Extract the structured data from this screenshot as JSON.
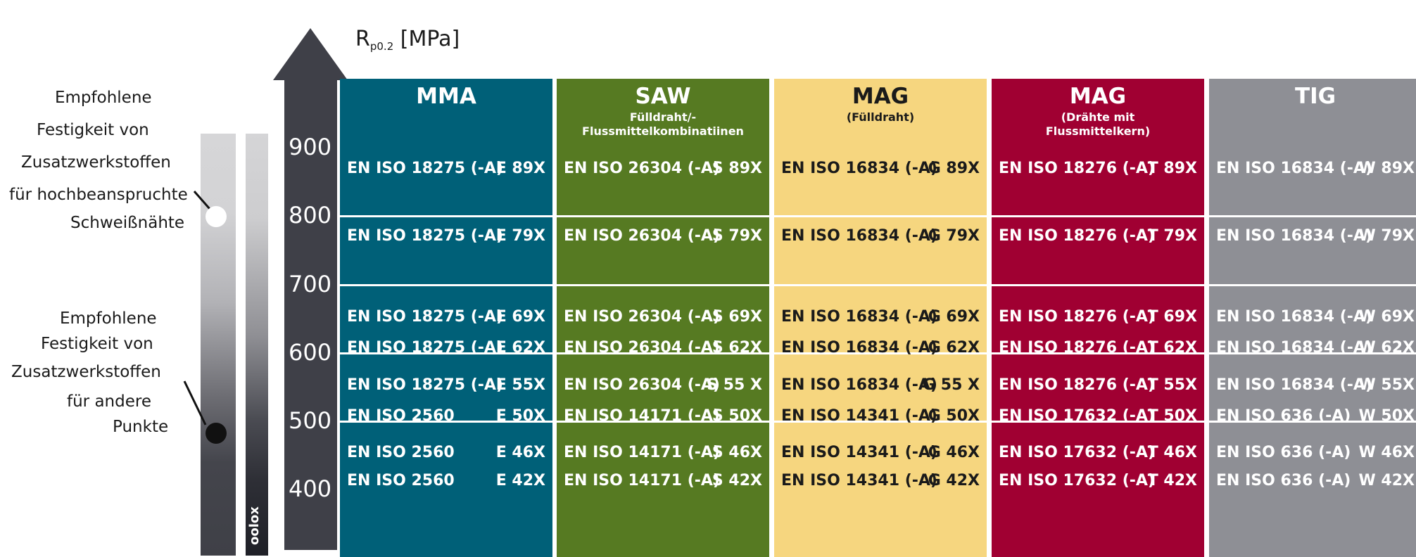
{
  "axis": {
    "label_main": "R",
    "label_sub": "p0.2",
    "label_unit": "[MPa]",
    "ticks": [
      "900",
      "800",
      "700",
      "600",
      "500",
      "400"
    ]
  },
  "notes": {
    "high": [
      "Empfohlene",
      "Festigkeit von",
      "Zusatzwerkstoffen",
      "für hochbeanspruchte",
      "Schweißnähte"
    ],
    "other": [
      "Empfohlene",
      "Festigkeit von",
      "Zusatzwerkstoffen",
      "für andere",
      "Punkte"
    ]
  },
  "bar2_label": "oolox",
  "columns": [
    {
      "title": "MMA",
      "subtitle": "",
      "bg": "#006078",
      "fg": "#ffffff",
      "rows": [
        [
          "EN ISO 18275 (-A)",
          "E 89X"
        ],
        [
          "EN ISO 18275 (-A)",
          "E 79X"
        ],
        [
          "EN ISO 18275 (-A)",
          "E 69X"
        ],
        [
          "EN ISO 18275 (-A)",
          "E 62X"
        ],
        [
          "EN ISO 18275 (-A)",
          "E 55X"
        ],
        [
          "EN ISO 2560",
          "E 50X"
        ],
        [
          "EN ISO 2560",
          "E 46X"
        ],
        [
          "EN ISO 2560",
          "E 42X"
        ]
      ]
    },
    {
      "title": "SAW",
      "subtitle": "Fülldraht/-\nFlussmittelkombinatiinen",
      "bg": "#567a22",
      "fg": "#ffffff",
      "rows": [
        [
          "EN ISO 26304 (-A)",
          "S 89X"
        ],
        [
          "EN ISO 26304 (-A)",
          "S 79X"
        ],
        [
          "EN ISO 26304 (-A)",
          "S 69X"
        ],
        [
          "EN ISO 26304 (-A)",
          "S 62X"
        ],
        [
          "EN ISO 26304 (-A)",
          "S 55 X"
        ],
        [
          "EN ISO 14171 (-A)",
          "S 50X"
        ],
        [
          "EN ISO 14171 (-A)",
          "S 46X"
        ],
        [
          "EN ISO 14171 (-A)",
          "S 42X"
        ]
      ]
    },
    {
      "title": "MAG",
      "subtitle": "(Fülldraht)",
      "bg": "#f6d67f",
      "fg": "#1a1a1a",
      "rows": [
        [
          "EN ISO 16834 (-A)",
          "G 89X"
        ],
        [
          "EN ISO 16834 (-A)",
          "G 79X"
        ],
        [
          "EN ISO 16834 (-A)",
          "G 69X"
        ],
        [
          "EN ISO 16834 (-A)",
          "G 62X"
        ],
        [
          "EN ISO 16834 (-A)",
          "G 55 X"
        ],
        [
          "EN ISO 14341 (-A)",
          "G 50X"
        ],
        [
          "EN ISO 14341 (-A)",
          "G 46X"
        ],
        [
          "EN ISO 14341 (-A)",
          "G 42X"
        ]
      ]
    },
    {
      "title": "MAG",
      "subtitle": "(Drähte mit\nFlussmittelkern)",
      "bg": "#a00032",
      "fg": "#ffffff",
      "rows": [
        [
          "EN ISO 18276 (-A)",
          "T 89X"
        ],
        [
          "EN ISO 18276 (-A)",
          "T 79X"
        ],
        [
          "EN ISO 18276 (-A)",
          "T 69X"
        ],
        [
          "EN ISO 18276 (-A)",
          "T 62X"
        ],
        [
          "EN ISO 18276 (-A)",
          "T 55X"
        ],
        [
          "EN ISO 17632 (-A)",
          "T 50X"
        ],
        [
          "EN ISO 17632 (-A)",
          "T 46X"
        ],
        [
          "EN ISO 17632 (-A)",
          "T 42X"
        ]
      ]
    },
    {
      "title": "TIG",
      "subtitle": "",
      "bg": "#8e8f95",
      "fg": "#ffffff",
      "rows": [
        [
          "EN ISO 16834 (-A)",
          "W 89X"
        ],
        [
          "EN ISO 16834 (-A)",
          "W 79X"
        ],
        [
          "EN ISO 16834 (-A)",
          "W 69X"
        ],
        [
          "EN ISO 16834 (-A)",
          "W 62X"
        ],
        [
          "EN ISO 16834 (-A)",
          "W 55X"
        ],
        [
          "EN ISO 636 (-A)",
          "W 50X"
        ],
        [
          "EN ISO 636 (-A)",
          "W 46X"
        ],
        [
          "EN ISO 636 (-A)",
          "W 42X"
        ]
      ]
    }
  ]
}
